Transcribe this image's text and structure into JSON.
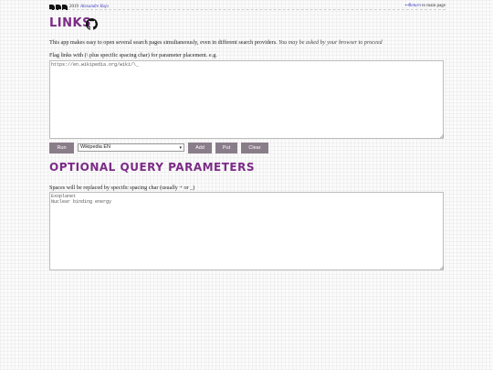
{
  "header": {
    "year": "2019",
    "author": "Alexandre Rojo",
    "return_link": "↩Return",
    "return_suffix": " to main page"
  },
  "links_section": {
    "title": "LINKS",
    "intro": "This app makes easy to open several search pages simultaneously, even in different search providers.",
    "intro_note": "You may be asked by your browser to proceed",
    "flag_text": "Flag links with (\\ plus specific spacing char) for parameter placement. e.g.",
    "urls_value": "https://en.wikipedia.org/wiki/\\_"
  },
  "controls": {
    "run_label": "Run",
    "select_value": "Wikipedia EN",
    "add_label": "Add",
    "put_label": "Put",
    "clear_label": "Clear"
  },
  "query_section": {
    "title": "OPTIONAL QUERY PARAMETERS",
    "hint": "Spaces will be replaced by specific spacing char (usually + or _)",
    "params_value": "Exoplanet\nNuclear binding energy"
  },
  "icons": {
    "github": "github-icon",
    "logo": "ddd-logo"
  },
  "colors": {
    "heading": "#7b2b86",
    "button": "#8a7d8a",
    "link": "#3a3ac0"
  }
}
